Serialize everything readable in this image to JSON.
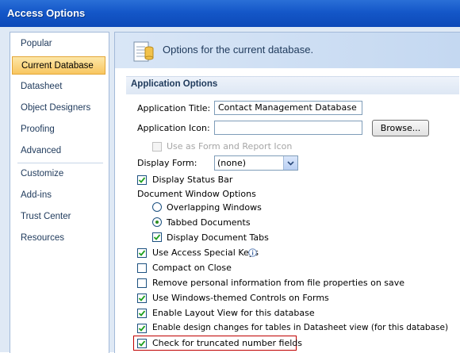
{
  "window": {
    "title": "Access Options"
  },
  "sidebar": {
    "items": [
      {
        "label": "Popular"
      },
      {
        "label": "Current Database"
      },
      {
        "label": "Datasheet"
      },
      {
        "label": "Object Designers"
      },
      {
        "label": "Proofing"
      },
      {
        "label": "Advanced"
      },
      {
        "label": "Customize"
      },
      {
        "label": "Add-ins"
      },
      {
        "label": "Trust Center"
      },
      {
        "label": "Resources"
      }
    ],
    "active": "Current Database"
  },
  "banner": {
    "text": "Options for the current database."
  },
  "section": {
    "title": "Application Options"
  },
  "app_title": {
    "label": "Application Title:",
    "value": "Contact Management Database"
  },
  "app_icon": {
    "label": "Application Icon:",
    "value": "",
    "browse_label": "Browse..."
  },
  "form_report_icon": {
    "label": "Use as Form and Report Icon",
    "checked": false,
    "enabled": false
  },
  "display_form": {
    "label": "Display Form:",
    "value": "(none)"
  },
  "status_bar": {
    "label": "Display Status Bar",
    "checked": true
  },
  "doc_window": {
    "label": "Document Window Options",
    "overlapping": {
      "label": "Overlapping Windows",
      "selected": false
    },
    "tabbed": {
      "label": "Tabbed Documents",
      "selected": true
    },
    "doc_tabs": {
      "label": "Display Document Tabs",
      "checked": true
    }
  },
  "options": [
    {
      "label": "Use Access Special Keys",
      "checked": true
    },
    {
      "label": "Compact on Close",
      "checked": false
    },
    {
      "label": "Remove personal information from file properties on save",
      "checked": false
    },
    {
      "label": "Use Windows-themed Controls on Forms",
      "checked": true
    },
    {
      "label": "Enable Layout View for this database",
      "checked": true
    },
    {
      "label": "Enable design changes for tables in Datasheet view (for this database)",
      "checked": true
    },
    {
      "label": "Check for truncated number fields",
      "checked": true
    }
  ],
  "colors": {
    "title_bar": "#1457c8",
    "active_item": "#f8c660",
    "highlight_border": "#c00000"
  }
}
